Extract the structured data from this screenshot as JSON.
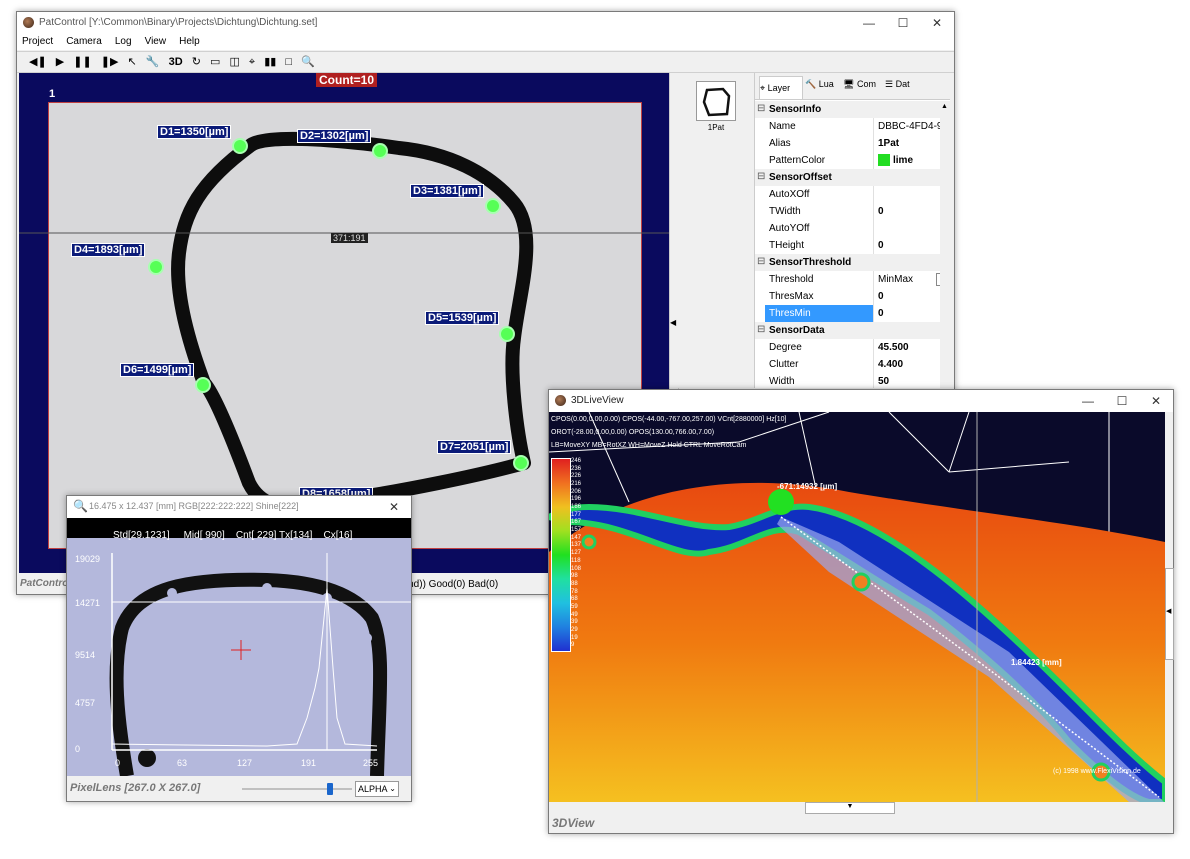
{
  "patcontrol": {
    "title": "PatControl [Y:\\Common\\Binary\\Projects\\Dichtung\\Dichtung.set]",
    "menus": [
      "Project",
      "Camera",
      "Log",
      "View",
      "Help"
    ],
    "toolbar_3d": "3D",
    "count_label": "Count=10",
    "view_number": "1",
    "coord_readout": "371:191",
    "measurements": [
      "D1=1350[µm]",
      "D2=1302[µm]",
      "D3=1381[µm]",
      "D4=1893[µm]",
      "D5=1539[µm]",
      "D6=1499[µm]",
      "D7=2051[µm]",
      "D8=1658[µm]"
    ],
    "status_title": "PatControl",
    "status_text": "n(ind)) Good(0) Bad(0)",
    "thumbnail_label": "1Pat",
    "tabs": [
      "Layer",
      "Lua",
      "Com",
      "Dat"
    ],
    "properties": {
      "cat_info": "SensorInfo",
      "name_k": "Name",
      "name_v": "DBBC-4FD4-9",
      "alias_k": "Alias",
      "alias_v": "1Pat",
      "pcolor_k": "PatternColor",
      "pcolor_v": "lime",
      "cat_offset": "SensorOffset",
      "autox_k": "AutoXOff",
      "autox_v": "",
      "twidth_k": "TWidth",
      "twidth_v": "0",
      "autoy_k": "AutoYOff",
      "autoy_v": "",
      "theight_k": "THeight",
      "theight_v": "0",
      "cat_threshold": "SensorThreshold",
      "threshold_k": "Threshold",
      "threshold_v": "MinMax",
      "thresmax_k": "ThresMax",
      "thresmax_v": "0",
      "thresmin_k": "ThresMin",
      "thresmin_v": "0",
      "cat_data": "SensorData",
      "degree_k": "Degree",
      "degree_v": "45.500",
      "clutter_k": "Clutter",
      "clutter_v": "4.400",
      "width_k": "Width",
      "width_v": "50"
    }
  },
  "pixellens": {
    "title": "16.475 x 12.437 [mm] RGB[222:222:222] Shine[222]",
    "stats": "Std[29.1231]     Mid[ 990]    Cnt[ 229] Tx[134]    Cx[16]",
    "y_ticks": [
      "19029",
      "14271",
      "9514",
      "4757",
      "0"
    ],
    "x_ticks": [
      "0",
      "63",
      "127",
      "191",
      "255"
    ],
    "status": "PixelLens  [267.0 X 267.0]",
    "select_value": "ALPHA",
    "slider_level": 0.82
  },
  "liveview3d": {
    "title": "3DLiveView",
    "info_line1": "CPOS(0.00,0.00,0.00) CPOS(-44.00,-767.00,257.00) VCnt[2880000] Hz[10]",
    "info_line2": "OROT(-28.00,0.00,0.00) OPOS(130.00,766.00,7.00)",
    "info_line3": "LB=MoveXY MB=RotXZ WH=MoveZ  Hold CTRL MoveRotCam",
    "color_scale": [
      "246",
      "236",
      "226",
      "216",
      "206",
      "196",
      "186",
      "177",
      "167",
      "157",
      "147",
      "137",
      "127",
      "118",
      "108",
      "98",
      "88",
      "78",
      "68",
      "59",
      "49",
      "39",
      "29",
      "19",
      "9"
    ],
    "point_label": "-671:14932 [µm]",
    "distance_label": "1.84423 [mm]",
    "copyright": "(c) 1998 www.FlexiVision.de",
    "status_title": "3DView"
  },
  "colors": {
    "dark_blue": "#0a0a5e",
    "marker_green": "#56ff56",
    "label_blue": "#0a1a78",
    "highlight": "#3399ff"
  }
}
